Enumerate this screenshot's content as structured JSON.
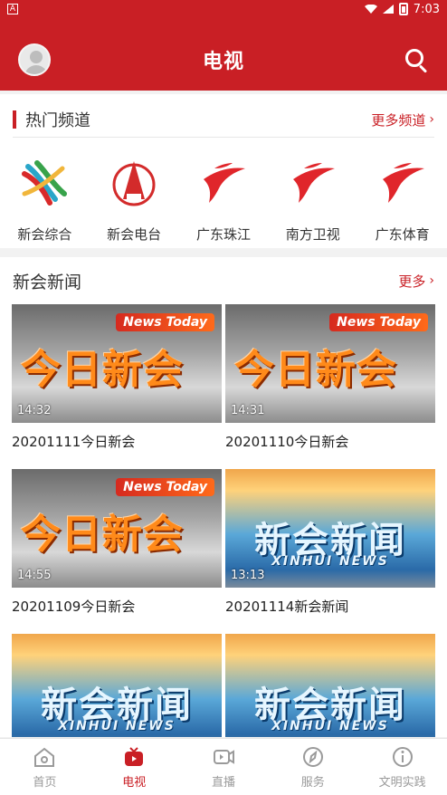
{
  "status": {
    "left_label": "A",
    "time": "7:03"
  },
  "appbar": {
    "title": "电视",
    "avatar_icon": "avatar-icon",
    "search_icon": "search-icon",
    "accent": "#c91f25"
  },
  "hot": {
    "title": "热门频道",
    "more": "更多频道",
    "channels": [
      {
        "name": "新会综合",
        "icon": "xinhui-general-logo"
      },
      {
        "name": "新会电台",
        "icon": "xinhui-radio-logo"
      },
      {
        "name": "广东珠江",
        "icon": "gdtv-logo"
      },
      {
        "name": "南方卫视",
        "icon": "gdtv-logo"
      },
      {
        "name": "广东体育",
        "icon": "gdtv-logo"
      }
    ]
  },
  "news": {
    "title": "新会新闻",
    "more": "更多",
    "items": [
      {
        "caption": "20201111今日新会",
        "duration": "14:32",
        "style": "jr",
        "tag": "News Today",
        "art": "今日新会"
      },
      {
        "caption": "20201110今日新会",
        "duration": "14:31",
        "style": "jr",
        "tag": "News Today",
        "art": "今日新会"
      },
      {
        "caption": "20201109今日新会",
        "duration": "14:55",
        "style": "jr",
        "tag": "News Today",
        "art": "今日新会"
      },
      {
        "caption": "20201114新会新闻",
        "duration": "13:13",
        "style": "xw",
        "art": "新会新闻",
        "sub": "XINHUI NEWS"
      },
      {
        "caption": "",
        "duration": "",
        "style": "xw",
        "art": "新会新闻",
        "sub": "XINHUI NEWS"
      },
      {
        "caption": "",
        "duration": "",
        "style": "xw",
        "art": "新会新闻",
        "sub": "XINHUI NEWS"
      }
    ]
  },
  "nav": {
    "items": [
      {
        "label": "首页",
        "icon": "home-icon",
        "active": false
      },
      {
        "label": "电视",
        "icon": "tv-icon",
        "active": true
      },
      {
        "label": "直播",
        "icon": "live-icon",
        "active": false
      },
      {
        "label": "服务",
        "icon": "compass-icon",
        "active": false
      },
      {
        "label": "文明实践",
        "icon": "info-icon",
        "active": false
      }
    ]
  }
}
